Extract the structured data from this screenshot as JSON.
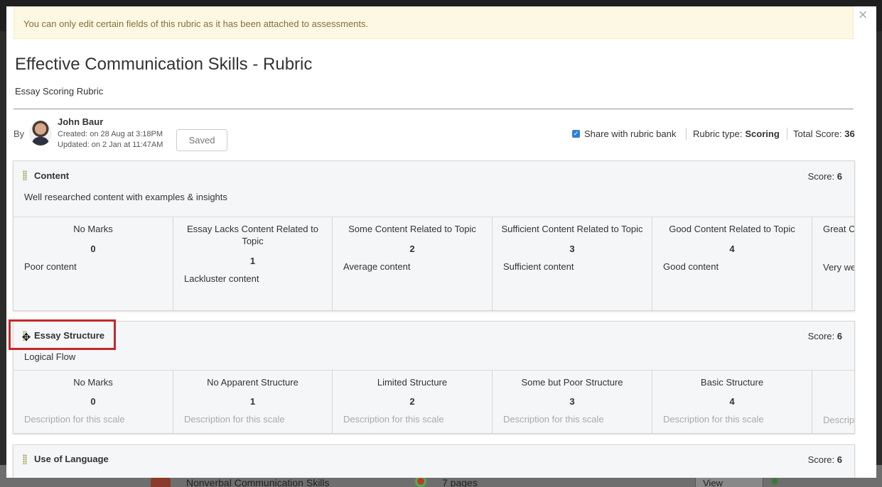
{
  "alert": {
    "text": "You can only edit certain fields of this rubric as it has been attached to assessments."
  },
  "close_label": "×",
  "rubric": {
    "title": "Effective Communication Skills - Rubric",
    "subtitle": "Essay Scoring Rubric"
  },
  "meta": {
    "by_label": "By",
    "author": "John Baur",
    "created": "Created: on 28 Aug at 3:18PM",
    "updated": "Updated: on 2 Jan at 11:47AM",
    "saved_label": "Saved",
    "share_label": "Share with rubric bank",
    "share_checked": true,
    "rubric_type_label": "Rubric type:",
    "rubric_type_value": "Scoring",
    "total_score_label": "Total Score:",
    "total_score_value": "36"
  },
  "criteria": [
    {
      "name": "Content",
      "score_label": "Score:",
      "score": "6",
      "description": "Well researched content with examples & insights",
      "scales": [
        {
          "title": "No Marks",
          "points": "0",
          "desc": "Poor content"
        },
        {
          "title": "Essay Lacks Content Related to Topic",
          "points": "1",
          "desc": "Lackluster content"
        },
        {
          "title": "Some Content Related to Topic",
          "points": "2",
          "desc": "Average content"
        },
        {
          "title": "Sufficient Content Related to Topic",
          "points": "3",
          "desc": "Sufficient content"
        },
        {
          "title": "Good Content Related to Topic",
          "points": "4",
          "desc": "Good content"
        },
        {
          "title": "Great C",
          "points": "",
          "desc": "Very we"
        }
      ]
    },
    {
      "name": "Essay Structure",
      "score_label": "Score:",
      "score": "6",
      "description": "Logical Flow",
      "scales": [
        {
          "title": "No Marks",
          "points": "0",
          "desc": "Description for this scale"
        },
        {
          "title": "No Apparent Structure",
          "points": "1",
          "desc": "Description for this scale"
        },
        {
          "title": "Limited Structure",
          "points": "2",
          "desc": "Description for this scale"
        },
        {
          "title": "Some but Poor Structure",
          "points": "3",
          "desc": "Description for this scale"
        },
        {
          "title": "Basic Structure",
          "points": "4",
          "desc": "Description for this scale"
        },
        {
          "title": "",
          "points": "",
          "desc": "Descrip"
        }
      ]
    },
    {
      "name": "Use of Language",
      "score_label": "Score:",
      "score": "6"
    }
  ],
  "background": {
    "row_title": "Nonverbal Communication Skills",
    "row_pages": "7 pages",
    "row_button": "View Progress"
  },
  "colors": {
    "alert_bg": "#fcf8e3",
    "alert_text": "#8a6d3b",
    "highlight": "#c62828",
    "checkbox": "#2f7fd6"
  }
}
